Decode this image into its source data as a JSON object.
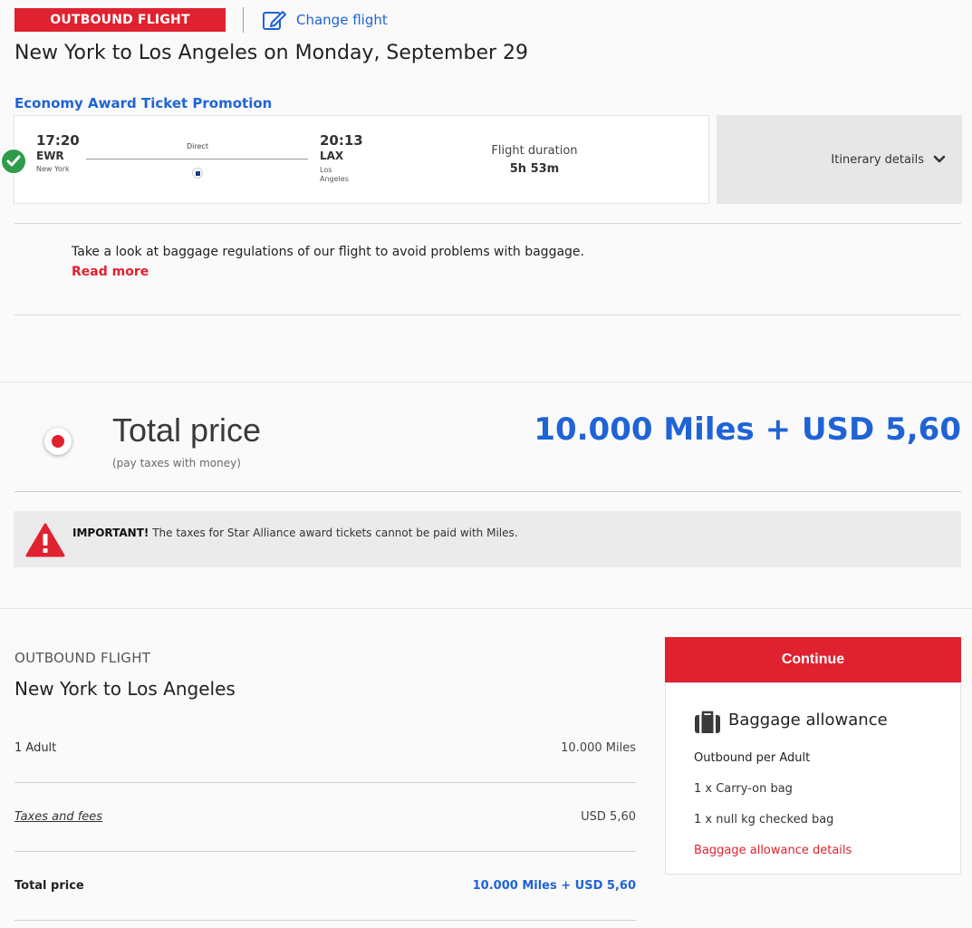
{
  "header": {
    "outbound_tag": "OUTBOUND FLIGHT",
    "change_flight": "Change flight",
    "route_title": "New York to Los Angeles on Monday, September 29"
  },
  "flight": {
    "promo": "Economy Award Ticket Promotion",
    "departure": {
      "time": "17:20",
      "code": "EWR",
      "city": "New York"
    },
    "arrival": {
      "time": "20:13",
      "code": "LAX",
      "city": "Los Angeles"
    },
    "stops": "Direct",
    "duration_label": "Flight duration",
    "duration": "5h 53m",
    "itinerary_details": "Itinerary details"
  },
  "baggage_note": {
    "text": "Take a look at baggage regulations of our flight to avoid problems with baggage.",
    "link": "Read more"
  },
  "total": {
    "label": "Total price",
    "sub": "(pay taxes with money)",
    "amount": "10.000 Miles + USD 5,60"
  },
  "important": {
    "strong": "IMPORTANT!",
    "text": "The taxes for Star Alliance award tickets cannot be paid with Miles."
  },
  "summary": {
    "label": "OUTBOUND FLIGHT",
    "route": "New York to Los Angeles",
    "rows": [
      {
        "label": "1 Adult",
        "value": "10.000 Miles"
      },
      {
        "label": "Taxes and fees",
        "value": "USD  5,60"
      },
      {
        "label": "Total price",
        "value": "10.000 Miles + USD  5,60"
      }
    ]
  },
  "continue_label": "Continue",
  "baggage": {
    "title": "Baggage allowance",
    "subtitle": "Outbound per Adult",
    "items": [
      "1 x Carry-on bag",
      "1 x null kg checked bag"
    ],
    "link": "Baggage allowance details"
  },
  "colors": {
    "brand_red": "#e0212f",
    "link_blue": "#1f63d6",
    "success_green": "#2e9c4a"
  }
}
